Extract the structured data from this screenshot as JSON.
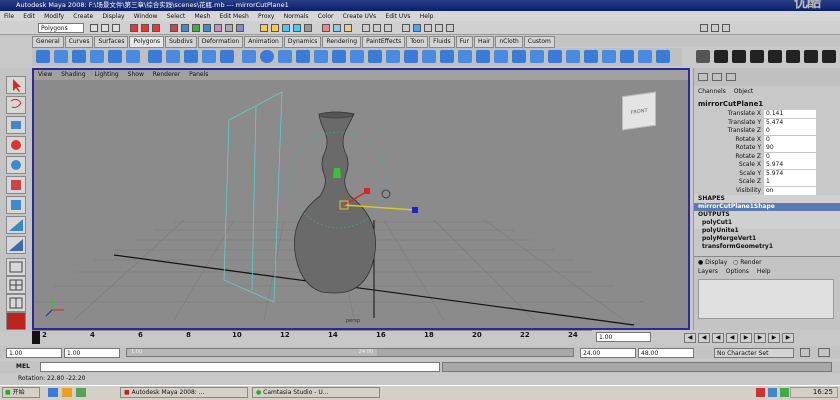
{
  "titlebar": {
    "title": "Autodesk Maya 2008: F:\\场景文件\\第三章\\综合实践\\scenes\\花瓶.mb  ---  mirrorCutPlane1",
    "watermark": "优酷"
  },
  "menubar": [
    "File",
    "Edit",
    "Modify",
    "Create",
    "Display",
    "Window",
    "Select",
    "Mesh",
    "Edit Mesh",
    "Proxy",
    "Normals",
    "Color",
    "Create UVs",
    "Edit UVs",
    "Help"
  ],
  "statusline": {
    "mode": "Polygons"
  },
  "shelf_tabs": [
    "General",
    "Curves",
    "Surfaces",
    "Polygons",
    "Subdivs",
    "Deformation",
    "Animation",
    "Dynamics",
    "Rendering",
    "PaintEffects",
    "Toon",
    "Fluids",
    "Fur",
    "Hair",
    "nCloth",
    "Custom"
  ],
  "shelf_active": "Polygons",
  "viewport": {
    "menu": [
      "View",
      "Shading",
      "Lighting",
      "Show",
      "Renderer",
      "Panels"
    ],
    "camera": "persp",
    "viewcube_label": "FRONT"
  },
  "channel_box": {
    "tabs": [
      "Channels",
      "Object"
    ],
    "object": "mirrorCutPlane1",
    "channels": [
      {
        "name": "Translate X",
        "value": "0.141"
      },
      {
        "name": "Translate Y",
        "value": "5.474"
      },
      {
        "name": "Translate Z",
        "value": "0"
      },
      {
        "name": "Rotate X",
        "value": "0"
      },
      {
        "name": "Rotate Y",
        "value": "90"
      },
      {
        "name": "Rotate Z",
        "value": "0"
      },
      {
        "name": "Scale X",
        "value": "5.974"
      },
      {
        "name": "Scale Y",
        "value": "5.974"
      },
      {
        "name": "Scale Z",
        "value": "1"
      },
      {
        "name": "Visibility",
        "value": "on"
      }
    ],
    "shapes_header": "SHAPES",
    "shape": "mirrorCutPlane1Shape",
    "outputs_header": "OUTPUTS",
    "outputs": [
      "polyCut1",
      "polyUnite1",
      "polyMergeVert1",
      "transformGeometry1"
    ]
  },
  "layers": {
    "radio_display": "Display",
    "radio_render": "Render",
    "menu": [
      "Layers",
      "Options",
      "Help"
    ]
  },
  "timeline": {
    "ticks": [
      "2",
      "4",
      "6",
      "8",
      "10",
      "12",
      "14",
      "16",
      "18",
      "20",
      "22",
      "24"
    ],
    "current_frame": "1.00"
  },
  "range": {
    "start": "1.00",
    "playback_start": "1.00",
    "range_start_label": "1.00",
    "range_end_label": "24.00",
    "playback_end": "24.00",
    "end": "48.00",
    "character_set": "No Character Set"
  },
  "mel": {
    "label": "MEL"
  },
  "help_line": "Rotation: 22.80   -22.20",
  "taskbar": {
    "start": "开始",
    "tasks": [
      "Autodesk Maya 2008: ...",
      "Camtasia Studio - U..."
    ],
    "clock": "16:25"
  },
  "colors": {
    "viewport_border": "#2a2a9a",
    "selection": "#5a7ab0",
    "titlebar": "#0a1e6a"
  }
}
